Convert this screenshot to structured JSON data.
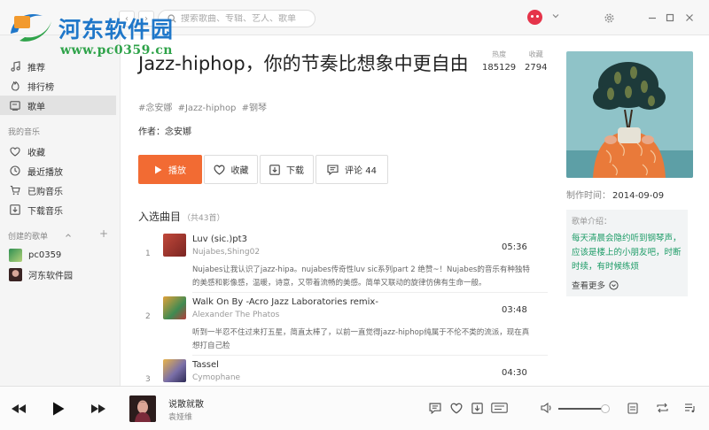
{
  "titlebar": {
    "watermark_title": "河东软件园",
    "watermark_url": "www.pc0359.cn",
    "search_placeholder": "搜索歌曲、专辑、艺人、歌单"
  },
  "sidebar": {
    "online_items": [
      {
        "label": "推荐",
        "icon": "music-note-icon"
      },
      {
        "label": "排行榜",
        "icon": "flame-icon"
      },
      {
        "label": "歌单",
        "icon": "playlist-icon",
        "active": true
      }
    ],
    "my_music_header": "我的音乐",
    "my_music_items": [
      {
        "label": "收藏",
        "icon": "heart-icon"
      },
      {
        "label": "最近播放",
        "icon": "clock-icon"
      },
      {
        "label": "已购音乐",
        "icon": "cart-icon"
      },
      {
        "label": "下载音乐",
        "icon": "download-icon"
      }
    ],
    "created_header": "创建的歌单",
    "created_playlists": [
      {
        "label": "pc0359"
      },
      {
        "label": "河东软件园"
      }
    ]
  },
  "playlist": {
    "title": "Jazz-hiphop，你的节奏比想象中更自由",
    "stats": [
      {
        "label": "热度",
        "value": "185129"
      },
      {
        "label": "收藏",
        "value": "2794"
      }
    ],
    "tags": [
      "#念安娜",
      "#Jazz-hiphop",
      "#钢琴"
    ],
    "author": "作者：念安娜",
    "buttons": {
      "play": "播放",
      "collect": "收藏",
      "download": "下载",
      "comment": "评论 44"
    },
    "tracks_heading": "入选曲目",
    "tracks_count": "（共43首）",
    "made_label": "制作时间：",
    "made_date": "2014-09-09",
    "intro_heading": "歌单介绍：",
    "intro_body": "每天清晨会隐约听到钢琴声，应该是楼上的小朋友吧，时断时续，有时候练烦",
    "intro_more": "查看更多"
  },
  "tracks": [
    {
      "num": "1",
      "name": "Luv (sic.)pt3",
      "artist": "Nujabes,Shing02",
      "duration": "05:36",
      "desc": "Nujabes让我认识了jazz-hipa。nujabes传奇性luv sic系列part 2 绝赞~！Nujabes的音乐有种独特的美感和影像感，温暖，诗意，又带着流畅的美感。简单又联动的旋律仿佛有生命一般。",
      "cover_color": "#b8433a"
    },
    {
      "num": "2",
      "name": "Walk On By -Acro Jazz Laboratories remix-",
      "artist": "Alexander The Phatos",
      "duration": "03:48",
      "desc": "听到一半忍不住过来打五星，简直太棒了，以前一直觉得jazz-hiphop纯属于不伦不类的流派，现在真想打自己脸",
      "cover_color": "#3f8a52"
    },
    {
      "num": "3",
      "name": "Tassel",
      "artist": "Cymophane",
      "duration": "04:30",
      "desc": "",
      "cover_color": "#7a6fa8"
    }
  ],
  "player": {
    "song": "说散就散",
    "artist": "袁娅维",
    "volume_fraction": 0.95,
    "accent": "#f26b33",
    "intro_color": "#1c9b66"
  }
}
